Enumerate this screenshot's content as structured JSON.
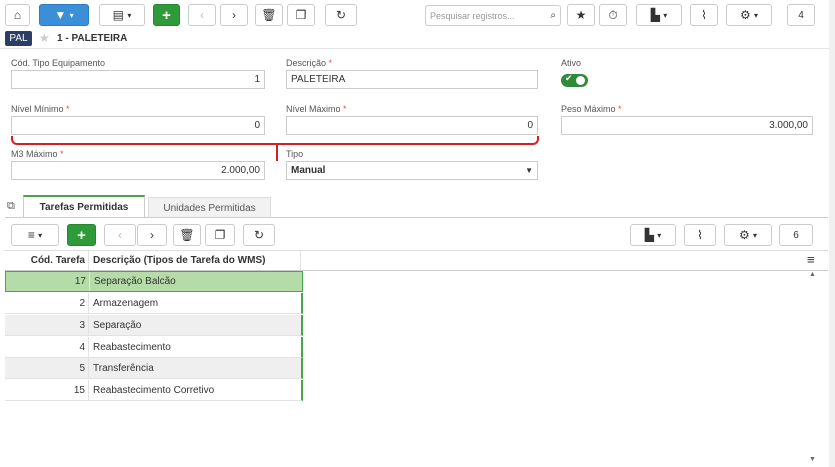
{
  "toolbar": {
    "search_placeholder": "Pesquisar registros...",
    "count": "4"
  },
  "header": {
    "badge": "PAL",
    "title": "1 - PALETEIRA"
  },
  "form": {
    "cod_label": "Cód. Tipo Equipamento",
    "cod_value": "1",
    "desc_label": "Descrição",
    "desc_value": "PALETEIRA",
    "ativo_label": "Ativo",
    "nivel_min_label": "Nível Mínimo",
    "nivel_min_value": "0",
    "nivel_max_label": "Nível Máximo",
    "nivel_max_value": "0",
    "peso_label": "Peso Máximo",
    "peso_value": "3.000,00",
    "m3_label": "M3 Máximo",
    "m3_value": "2.000,00",
    "tipo_label": "Tipo",
    "tipo_value": "Manual",
    "required_mark": "*"
  },
  "tabs": [
    {
      "label": "Tarefas Permitidas"
    },
    {
      "label": "Unidades Permitidas"
    }
  ],
  "grid": {
    "count": "6",
    "headers": [
      "Cód. Tarefa",
      "Descrição (Tipos de Tarefa do WMS)"
    ],
    "rows": [
      [
        "17",
        "Separação Balcão"
      ],
      [
        "2",
        "Armazenagem"
      ],
      [
        "3",
        "Separação"
      ],
      [
        "4",
        "Reabastecimento"
      ],
      [
        "5",
        "Transferência"
      ],
      [
        "15",
        "Reabastecimento Corretivo"
      ]
    ]
  },
  "colors": {
    "blue": "#3a8fd8",
    "green": "#2e9a3a",
    "required": "#d9534f",
    "selected_row": "#b5dba8"
  }
}
